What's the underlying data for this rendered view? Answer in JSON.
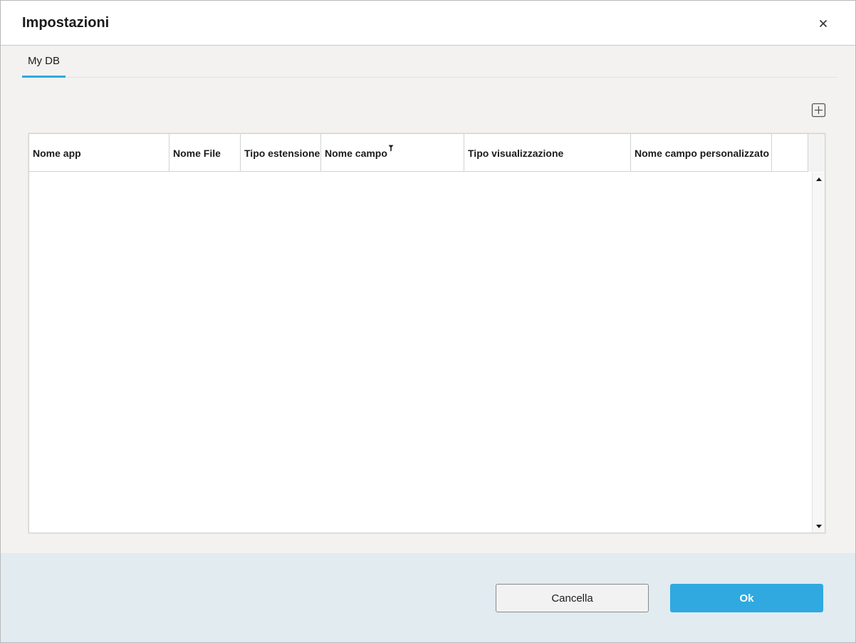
{
  "dialog": {
    "title": "Impostazioni"
  },
  "tabs": [
    {
      "label": "My DB",
      "selected": true
    }
  ],
  "grid": {
    "columns": [
      {
        "label": "Nome app"
      },
      {
        "label": "Nome File"
      },
      {
        "label": "Tipo estensione"
      },
      {
        "label": "Nome campo",
        "filter_icon": "filter-icon"
      },
      {
        "label": "Tipo visualizzazione"
      },
      {
        "label": "Nome campo personalizzato"
      }
    ],
    "rows": []
  },
  "footer": {
    "cancel_label": "Cancella",
    "ok_label": "Ok"
  },
  "colors": {
    "accent": "#2fa9e0",
    "footer_bg": "#e1ebf0",
    "body_bg": "#f3f2f1"
  }
}
